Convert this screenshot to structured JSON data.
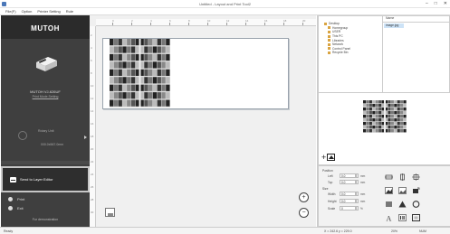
{
  "window": {
    "title": "Untitled - Layout and Print Tool2",
    "controls": [
      "–",
      "□",
      "✕"
    ]
  },
  "menu": [
    "File(F)",
    "Option",
    "Printer Setting",
    "Rule"
  ],
  "left_panel": {
    "brand": "MUTOH",
    "model": "MUTOH VJ-626UF",
    "mode": "Print Mode Setting",
    "rotary_label": "Rotary Unit",
    "rotary_size": "000.0x567.0mm",
    "send_button": "Send to Layer Editor",
    "item2_label": "Print",
    "exit_label": "Exit",
    "footer": "For demonstration",
    "icons": [
      "printer-icon",
      "rotary-icon",
      "layer-editor-icon",
      "exit-icon"
    ]
  },
  "ruler": {
    "top_marks": [
      "0",
      "2",
      "4",
      "6",
      "8",
      "10",
      "12",
      "14",
      "16",
      "18",
      "20"
    ],
    "left_marks": [
      "2",
      "4",
      "6",
      "8",
      "10",
      "12",
      "14",
      "16",
      "18",
      "20",
      "22",
      "24",
      "26",
      "28",
      "30"
    ]
  },
  "tree": [
    {
      "label": "Desktop",
      "depth": 0
    },
    {
      "label": "Homegroup",
      "depth": 1
    },
    {
      "label": "USER",
      "depth": 1
    },
    {
      "label": "This PC",
      "depth": 1
    },
    {
      "label": "Libraries",
      "depth": 1
    },
    {
      "label": "Network",
      "depth": 1
    },
    {
      "label": "Control Panel",
      "depth": 1
    },
    {
      "label": "Recycle Bin",
      "depth": 1
    }
  ],
  "filelist": {
    "header": "Name",
    "selected": "image.jpg"
  },
  "properties": {
    "position_label": "Position",
    "left_label": "Left",
    "left_value": "0.0",
    "top_label": "Top",
    "top_value": "0.0",
    "size_label": "Size",
    "width_label": "Width",
    "width_value": "0.0",
    "height_label": "Height",
    "height_value": "0.0",
    "scale_label": "Scale",
    "scale_value": "0",
    "unit_mm": "mm",
    "unit_pct": "%"
  },
  "status": {
    "left": "Ready",
    "coords": "X = 242.6  y = 229.0",
    "zoom": "20%",
    "mode": "NUM"
  },
  "colors": {
    "panel_dark": "#3f3f3f",
    "brand_bg": "#2b2b2b",
    "selection": "#cde3f7",
    "send_border": "#c6c6c6"
  }
}
